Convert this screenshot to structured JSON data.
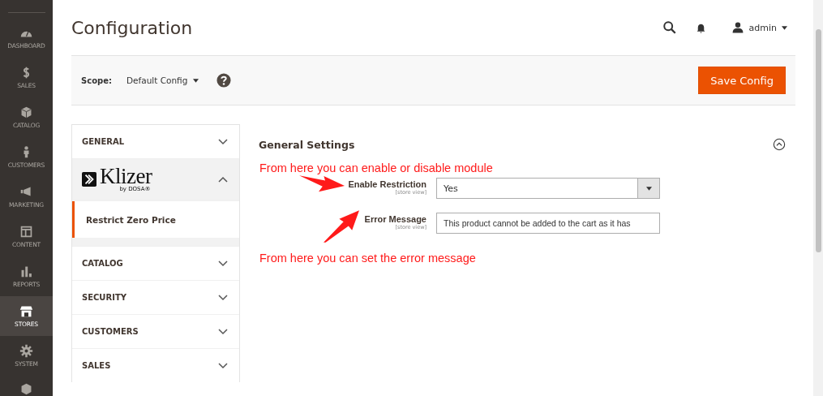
{
  "nav": [
    {
      "label": "DASHBOARD",
      "selected": false
    },
    {
      "label": "SALES",
      "selected": false
    },
    {
      "label": "CATALOG",
      "selected": false
    },
    {
      "label": "CUSTOMERS",
      "selected": false
    },
    {
      "label": "MARKETING",
      "selected": false
    },
    {
      "label": "CONTENT",
      "selected": false
    },
    {
      "label": "REPORTS",
      "selected": false
    },
    {
      "label": "STORES",
      "selected": true
    },
    {
      "label": "SYSTEM",
      "selected": false
    }
  ],
  "page_title": "Configuration",
  "user": "admin",
  "scope": {
    "label": "Scope:",
    "value": "Default Config"
  },
  "save_button": "Save Config",
  "sections": [
    {
      "kind": "text",
      "label": "GENERAL",
      "expanded": false
    },
    {
      "kind": "logo",
      "label": "Klizer",
      "sublabel": "by DOSA®",
      "expanded": true,
      "children": [
        {
          "label": "Restrict Zero Price",
          "selected": true
        }
      ]
    },
    {
      "kind": "text",
      "label": "CATALOG",
      "expanded": false
    },
    {
      "kind": "text",
      "label": "SECURITY",
      "expanded": false
    },
    {
      "kind": "text",
      "label": "CUSTOMERS",
      "expanded": false
    },
    {
      "kind": "text",
      "label": "SALES",
      "expanded": false
    }
  ],
  "group": {
    "title": "General Settings",
    "expanded": true
  },
  "fields": [
    {
      "kind": "select",
      "label": "Enable Restriction",
      "scope": "[store view]",
      "value": "Yes"
    },
    {
      "kind": "text",
      "label": "Error Message",
      "scope": "[store view]",
      "value": "This product cannot be added to the cart as it has"
    }
  ],
  "annotations": [
    "From here you can enable or disable module",
    "From here you can set the error message"
  ]
}
